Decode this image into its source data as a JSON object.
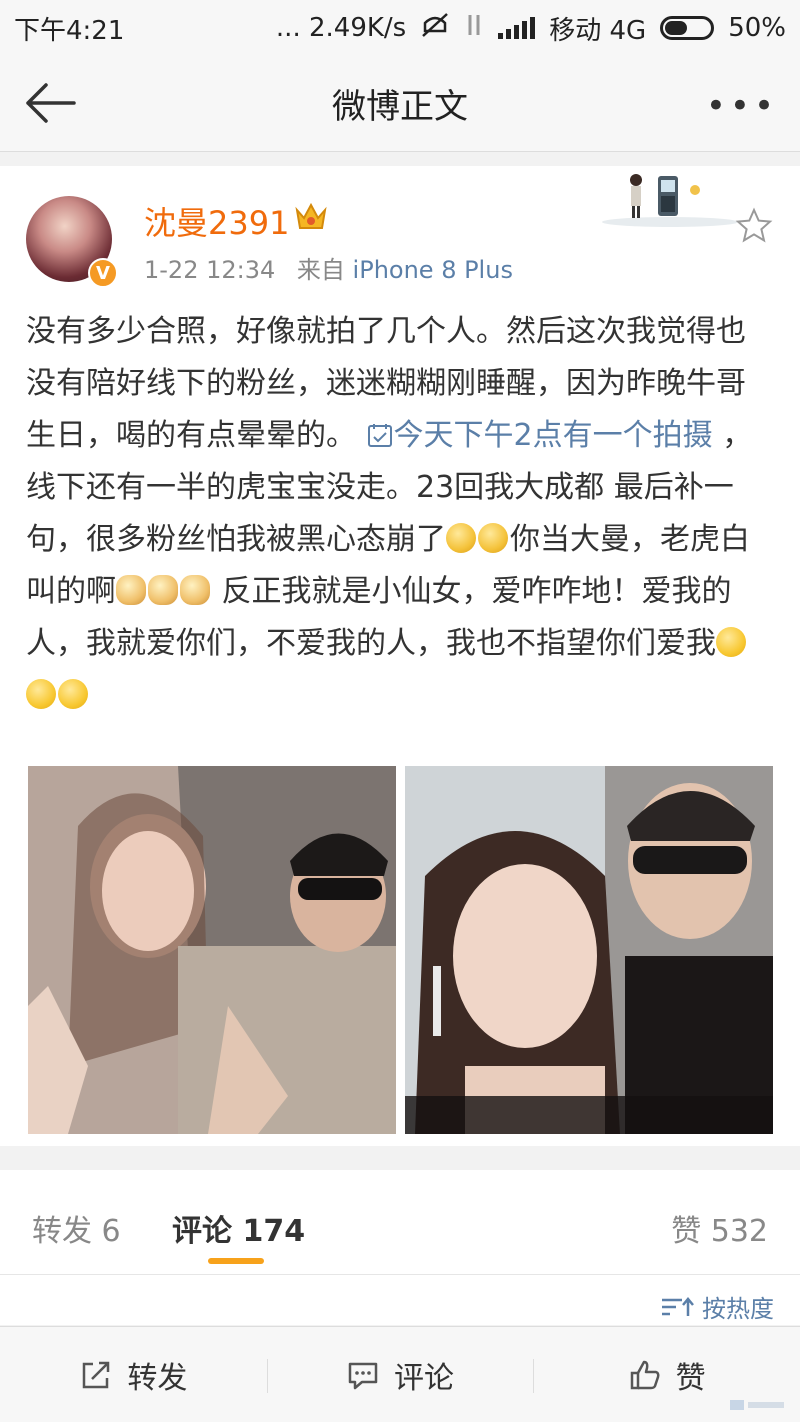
{
  "status_bar": {
    "time": "下午4:21",
    "speed": "... 2.49K/s",
    "carrier": "移动 4G",
    "battery": "50%",
    "battery_level": 0.5
  },
  "header": {
    "title": "微博正文"
  },
  "post": {
    "username": "沈曼2391",
    "timestamp": "1-22 12:34",
    "source_prefix": "来自",
    "source": "iPhone 8 Plus",
    "text_1": "没有多少合照，好像就拍了几个人。然后这次我觉得也没有陪好线下的粉丝，迷迷糊糊刚睡醒，因为昨晚牛哥生日，喝的有点晕晕的。",
    "topic": "今天下午2点有一个拍摄",
    "text_2": "，线下还有一半的虎宝宝没走。23回我大成都 最后补一句，很多粉丝怕我被黑心态崩了",
    "text_3": "你当大曼，老虎白叫的啊",
    "text_4": "反正我就是小仙女，爱咋咋地！爱我的人，我就爱你们，不爱我的人，我也不指望你们爱我"
  },
  "tabs": {
    "repost": "转发 6",
    "comments": "评论 174",
    "likes": "赞 532"
  },
  "sort": {
    "label": "按热度"
  },
  "toolbar": {
    "repost_label": "转发",
    "comment_label": "评论",
    "like_label": "赞"
  }
}
